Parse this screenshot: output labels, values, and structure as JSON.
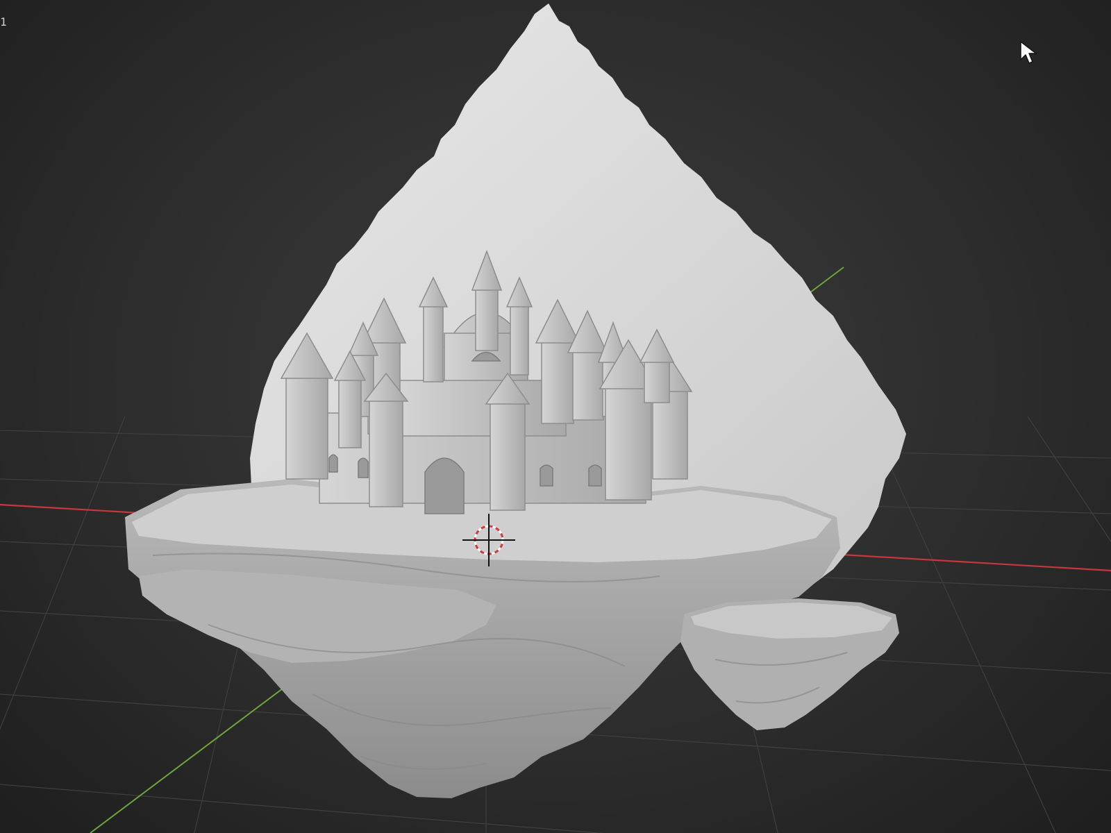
{
  "viewport": {
    "frame_label": "1",
    "background_color": "#2d2d2d",
    "axis_colors": {
      "x_axis": "#c8373c",
      "y_axis": "#6aa83a"
    },
    "model_color": "#bdbdbd",
    "backdrop_color": "#dcdcdc"
  },
  "icons": {
    "cursor": "mouse-pointer-icon",
    "origin_cursor": "3d-cursor-icon"
  }
}
